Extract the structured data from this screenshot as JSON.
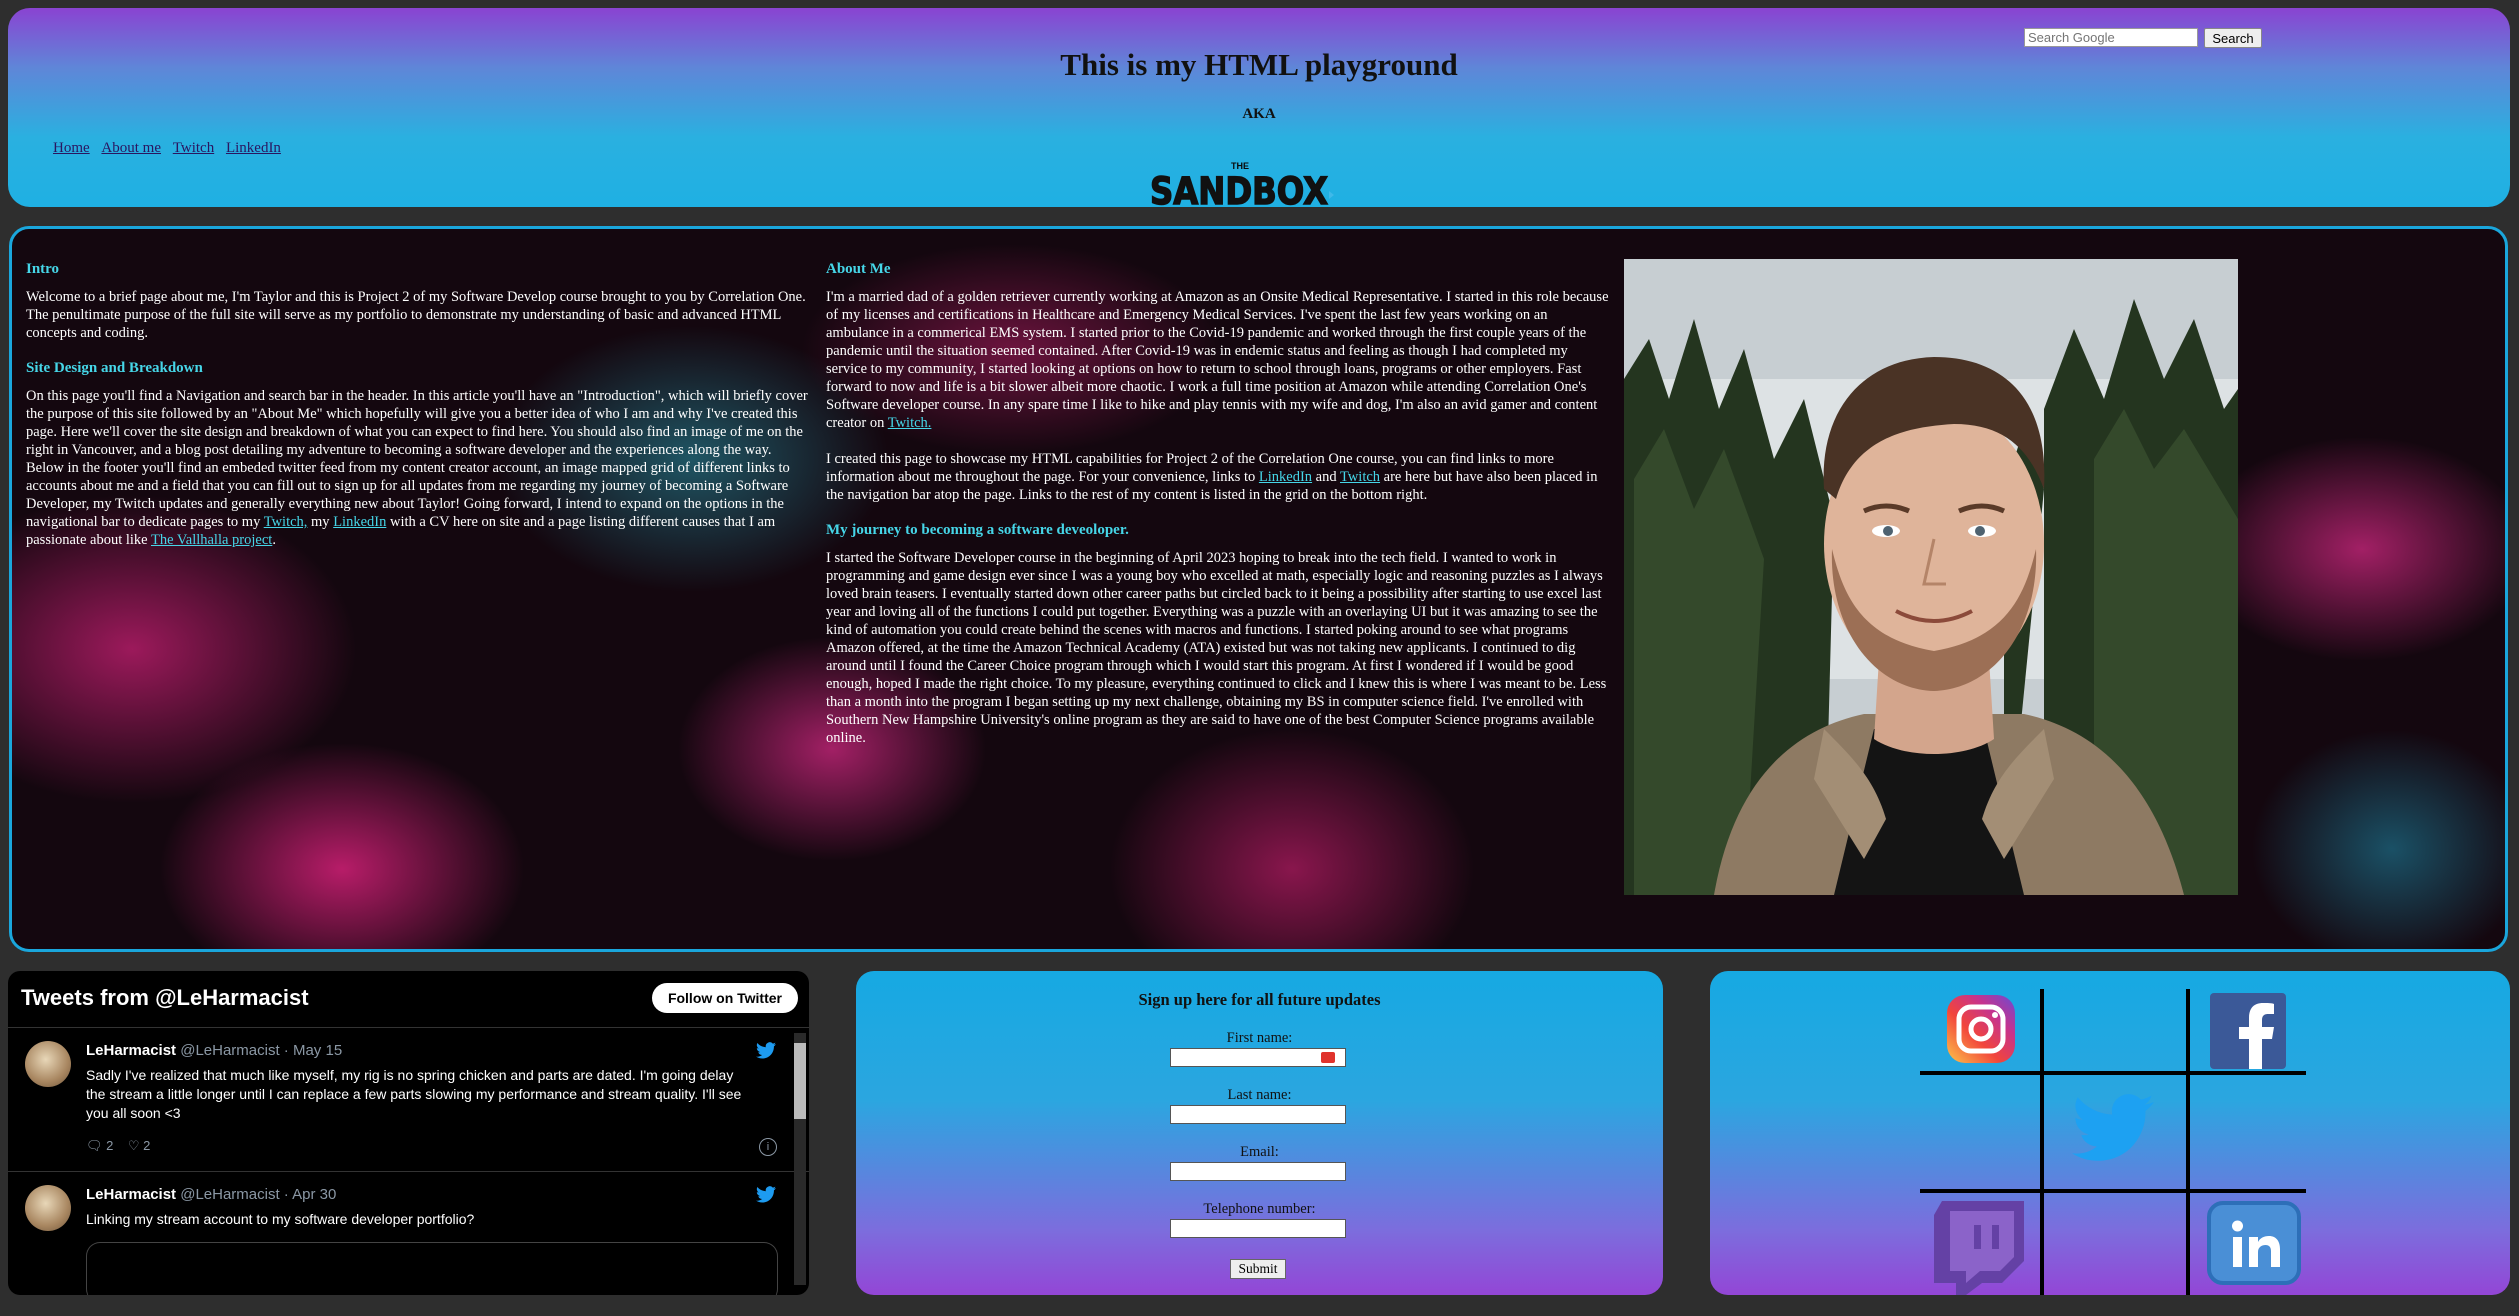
{
  "header": {
    "search_placeholder": "Search Google",
    "search_button": "Search",
    "title": "This is my HTML playground",
    "aka": "AKA",
    "logo_small": "THE",
    "logo_text": "SANDBOX",
    "nav": [
      "Home",
      "About me",
      "Twitch",
      "LinkedIn"
    ]
  },
  "intro": {
    "heading": "Intro",
    "text": "Welcome to a brief page about me, I'm Taylor and this is Project 2 of my Software Develop course brought to you by Correlation One. The penultimate purpose of the full site will serve as my portfolio to demonstrate my understanding of basic and advanced HTML concepts and coding."
  },
  "design": {
    "heading": "Site Design and Breakdown",
    "text": "On this page you'll find a Navigation and search bar in the header. In this article you'll have an \"Introduction\", which will briefly cover the purpose of this site followed by an \"About Me\" which hopefully will give you a better idea of who I am and why I've created this page. Here we'll cover the site design and breakdown of what you can expect to find here. You should also find an image of me on the right in Vancouver, and a blog post detailing my adventure to becoming a software developer and the experiences along the way. Below in the footer you'll find an embeded twitter feed from my content creator account, an image mapped grid of different links to accounts about me and a field that you can fill out to sign up for all updates from me regarding my journey of becoming a Software Developer, my Twitch updates and generally everything new about Taylor! Going forward, I intend to expand on the options in the navigational bar to dedicate pages to my",
    "link1": "Twitch,",
    "mid1": " my ",
    "link2": "LinkedIn",
    "mid2": " with a CV here on site and a page listing different causes that I am passionate about like ",
    "link3": "The Vallhalla project",
    "end": "."
  },
  "about": {
    "heading": "About Me",
    "p1": "I'm a married dad of a golden retriever currently working at Amazon as an Onsite Medical Representative. I started in this role because of my licenses and certifications in Healthcare and Emergency Medical Services. I've spent the last few years working on an ambulance in a commerical EMS system. I started prior to the Covid-19 pandemic and worked through the first couple years of the pandemic until the situation seemed contained. After Covid-19 was in endemic status and feeling as though I had completed my service to my community, I started looking at options on how to return to school through loans, programs or other employers. Fast forward to now and life is a bit slower albeit more chaotic. I work a full time position at Amazon while attending Correlation One's Software developer course. In any spare time I like to hike and play tennis with my wife and dog, I'm also an avid gamer and content creator on ",
    "p1_link": "Twitch.",
    "p2_a": "I created this page to showcase my HTML capabilities for Project 2 of the Correlation One course, you can find links to more information about me throughout the page. For your convenience, links to ",
    "p2_link1": "LinkedIn",
    "p2_b": " and ",
    "p2_link2": "Twitch",
    "p2_c": " are here but have also been placed in the navigation bar atop the page. Links to the rest of my content is listed in the grid on the bottom right."
  },
  "journey": {
    "heading": "My journey to becoming a software deveoloper.",
    "text": "I started the Software Developer course in the beginning of April 2023 hoping to break into the tech field. I wanted to work in programming and game design ever since I was a young boy who excelled at math, especially logic and reasoning puzzles as I always loved brain teasers. I eventually started down other career paths but circled back to it being a possibility after starting to use excel last year and loving all of the functions I could put together. Everything was a puzzle with an overlaying UI but it was amazing to see the kind of automation you could create behind the scenes with macros and functions. I started poking around to see what programs Amazon offered, at the time the Amazon Technical Academy (ATA) existed but was not taking new applicants. I continued to dig around until I found the Career Choice program through which I would start this program. At first I wondered if I would be good enough, hoped I made the right choice. To my pleasure, everything continued to click and I knew this is where I was meant to be. Less than a month into the program I began setting up my next challenge, obtaining my BS in computer science field. I've enrolled with Southern New Hampshire University's online program as they are said to have one of the best Computer Science programs available online."
  },
  "twitter": {
    "title": "Tweets from @LeHarmacist",
    "follow": "Follow on Twitter",
    "tweets": [
      {
        "name": "LeHarmacist",
        "meta": "@LeHarmacist · May 15",
        "text": "Sadly I've realized that much like myself, my rig is no spring chicken and parts are dated.  I'm going delay the stream a little longer until I can replace a few parts slowing my performance and stream quality.  I'll see you all soon <3",
        "replies": "2",
        "likes": "2"
      },
      {
        "name": "LeHarmacist",
        "meta": "@LeHarmacist · Apr 30",
        "text": "Linking my stream account to my software developer portfolio?"
      }
    ]
  },
  "signup": {
    "heading": "Sign up here for all future updates",
    "labels": [
      "First name:",
      "Last name:",
      "Email:",
      "Telephone number:"
    ],
    "submit": "Submit"
  },
  "social": {
    "icons": [
      "instagram-icon",
      "facebook-icon",
      "twitter-icon",
      "twitch-icon",
      "linkedin-icon"
    ],
    "colors": {
      "facebook": "#3b5998",
      "twitter": "#1da1f2",
      "twitch": "#6441a5",
      "linkedin": "#0a66c2"
    }
  }
}
